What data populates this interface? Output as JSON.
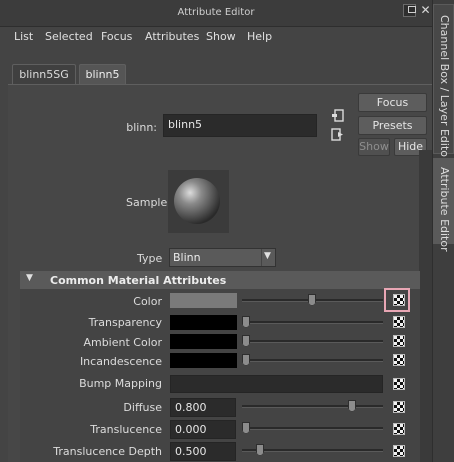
{
  "window": {
    "title": "Attribute Editor"
  },
  "menu": [
    "List",
    "Selected",
    "Focus",
    "Attributes",
    "Show",
    "Help"
  ],
  "tabs": [
    "blinn5SG",
    "blinn5"
  ],
  "node": {
    "label": "blinn:",
    "value": "blinn5"
  },
  "buttons": {
    "focus": "Focus",
    "presets": "Presets",
    "show": "Show",
    "hide": "Hide"
  },
  "sample": {
    "label": "Sample"
  },
  "type": {
    "label": "Type",
    "value": "Blinn"
  },
  "section": {
    "title": "Common Material Attributes"
  },
  "attrs": [
    {
      "label": "Color",
      "swatch": "#7a7a7a",
      "slider": 0.5
    },
    {
      "label": "Transparency",
      "swatch": "#000000",
      "slider": 0.0
    },
    {
      "label": "Ambient Color",
      "swatch": "#000000",
      "slider": 0.0
    },
    {
      "label": "Incandescence",
      "swatch": "#000000",
      "slider": 0.0
    },
    {
      "label": "Bump Mapping"
    },
    {
      "label": "Diffuse",
      "value": "0.800",
      "slider": 0.8
    },
    {
      "label": "Translucence",
      "value": "0.000",
      "slider": 0.0
    },
    {
      "label": "Translucence Depth",
      "value": "0.500",
      "slider": 0.1
    }
  ],
  "side_tabs": {
    "channel_box": "Channel Box / Layer Editor",
    "attribute_editor": "Attribute Editor"
  },
  "colors": {
    "highlight": "#e8a6b4",
    "panel": "#444444"
  }
}
